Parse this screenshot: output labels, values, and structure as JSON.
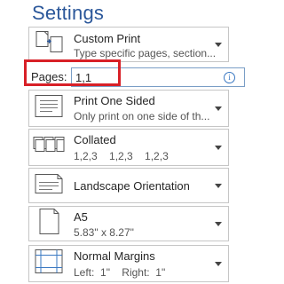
{
  "heading": "Settings",
  "print_range": {
    "title": "Custom Print",
    "subtitle": "Type specific pages, section...",
    "icon": "custom-print-icon"
  },
  "pages": {
    "label": "Pages:",
    "value": "1,1",
    "info_glyph": "i"
  },
  "sides": {
    "title": "Print One Sided",
    "subtitle": "Only print on one side of th...",
    "icon": "one-sided-icon"
  },
  "collation": {
    "title": "Collated",
    "subtitle": "1,2,3    1,2,3    1,2,3",
    "icon": "collated-icon"
  },
  "orientation": {
    "title": "Landscape Orientation",
    "icon": "landscape-icon"
  },
  "paper_size": {
    "title": "A5",
    "subtitle": "5.83\" x 8.27\"",
    "icon": "paper-size-icon"
  },
  "margins": {
    "title": "Normal Margins",
    "subtitle": "Left:  1\"    Right:  1\"",
    "icon": "margins-icon"
  },
  "colors": {
    "heading": "#2b579a",
    "highlight": "#d82027",
    "border": "#c6c6c6"
  }
}
